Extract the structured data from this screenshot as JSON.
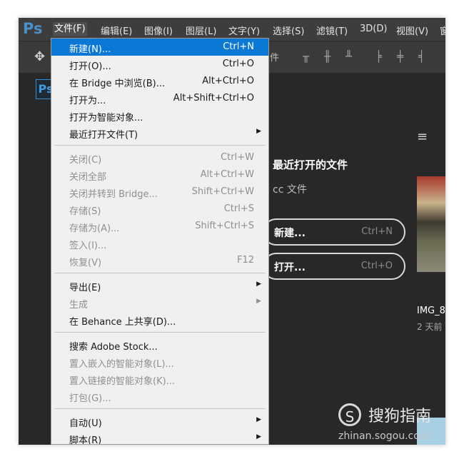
{
  "app": {
    "logo": "Ps"
  },
  "menubar": {
    "items": [
      "文件(F)",
      "编辑(E)",
      "图像(I)",
      "图层(L)",
      "文字(Y)",
      "选择(S)",
      "滤镜(T)",
      "3D(D)",
      "视图(V)",
      "窗"
    ]
  },
  "optionsbar": {
    "partial_text": "件"
  },
  "document_tab": {
    "label": "Ps"
  },
  "start_panel": {
    "recent_title": "最近打开的文件",
    "cc_files": "cc 文件",
    "new_button": {
      "label": "新建...",
      "shortcut": "Ctrl+N"
    },
    "open_button": {
      "label": "打开...",
      "shortcut": "Ctrl+O"
    },
    "thumbnail": {
      "name": "IMG_8",
      "time": "2 天前"
    }
  },
  "watermark": {
    "symbol": "S",
    "text": "搜狗指南",
    "url": "zhinan.sogou.com"
  },
  "file_menu": {
    "items": [
      {
        "label": "新建(N)...",
        "shortcut": "Ctrl+N"
      },
      {
        "label": "打开(O)...",
        "shortcut": "Ctrl+O"
      },
      {
        "label": "在 Bridge 中浏览(B)...",
        "shortcut": "Alt+Ctrl+O"
      },
      {
        "label": "打开为...",
        "shortcut": "Alt+Shift+Ctrl+O"
      },
      {
        "label": "打开为智能对象...",
        "shortcut": ""
      },
      {
        "label": "最近打开文件(T)",
        "shortcut": ""
      },
      {
        "label": "关闭(C)",
        "shortcut": "Ctrl+W"
      },
      {
        "label": "关闭全部",
        "shortcut": "Alt+Ctrl+W"
      },
      {
        "label": "关闭并转到 Bridge...",
        "shortcut": "Shift+Ctrl+W"
      },
      {
        "label": "存储(S)",
        "shortcut": "Ctrl+S"
      },
      {
        "label": "存储为(A)...",
        "shortcut": "Shift+Ctrl+S"
      },
      {
        "label": "签入(I)...",
        "shortcut": ""
      },
      {
        "label": "恢复(V)",
        "shortcut": "F12"
      },
      {
        "label": "导出(E)",
        "shortcut": ""
      },
      {
        "label": "生成",
        "shortcut": ""
      },
      {
        "label": "在 Behance 上共享(D)...",
        "shortcut": ""
      },
      {
        "label": "搜索 Adobe Stock...",
        "shortcut": ""
      },
      {
        "label": "置入嵌入的智能对象(L)...",
        "shortcut": ""
      },
      {
        "label": "置入链接的智能对象(K)...",
        "shortcut": ""
      },
      {
        "label": "打包(G)...",
        "shortcut": ""
      },
      {
        "label": "自动(U)",
        "shortcut": ""
      },
      {
        "label": "脚本(R)",
        "shortcut": ""
      }
    ]
  },
  "colors": {
    "highlight": "#0b78d6",
    "menubar": "#3d3d3d",
    "workspace": "#282828",
    "ps_blue": "#4a90c8"
  }
}
